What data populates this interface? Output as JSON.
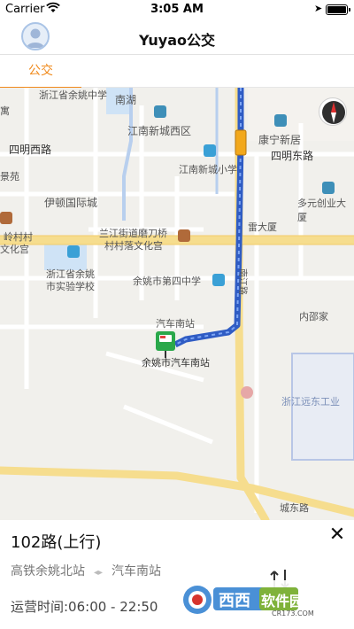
{
  "statusbar": {
    "carrier": "Carrier",
    "time": "3:05 AM"
  },
  "navbar": {
    "title": "Yuyao公交"
  },
  "tabs": [
    {
      "label": "公交",
      "active": true
    }
  ],
  "map": {
    "labels": {
      "road_nanhu": "南湖",
      "school_top": "浙江省余姚中学",
      "jiangnan_west": "江南新城西区",
      "siming_west": "四明西路",
      "siming_east": "四明东路",
      "kangning": "康宁新居",
      "jiangnan_xiaoxue": "江南新城小学",
      "yidun": "伊顿国际城",
      "duoyuan": "多元创业大厦",
      "leidasha": "雷大厦",
      "lanjiang_1": "兰江街道磨刀桥",
      "lanjiang_2": "村村落文化宫",
      "ling_village_1": "岭村村",
      "ling_village_2": "文化宫",
      "school_exp_1": "浙江省余姚",
      "school_exp_2": "市实验学校",
      "no4_school": "余姚市第四中学",
      "neishaojia": "内邵家",
      "bus_south_top": "汽车南站",
      "bus_south_station": "余姚市汽车南站",
      "yuandong": "浙江远东工业",
      "chengdong": "城东路",
      "kai_road": "南江路",
      "jingyuan": "景苑",
      "yu": "寓"
    },
    "compass_label": "北"
  },
  "route": {
    "name": "102路(上行)",
    "from": "高铁余姚北站",
    "to": "汽车南站",
    "hours": "运营时间:06:00 - 22:50"
  },
  "watermark": {
    "brand": "西西",
    "text": "软件园",
    "url": "CR173.COM"
  },
  "colors": {
    "accent": "#f08a1c",
    "route": "#3a6fd8",
    "bus": "#f2a81c"
  }
}
